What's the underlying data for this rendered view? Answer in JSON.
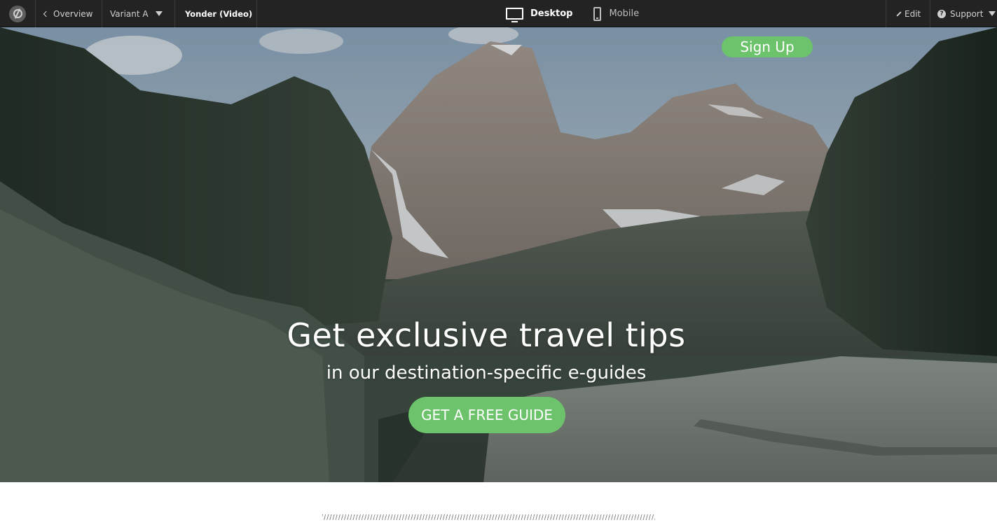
{
  "toolbar": {
    "overview_label": "Overview",
    "variant_label": "Variant A",
    "page_name": "Yonder (Video)",
    "devices": [
      {
        "label": "Desktop",
        "icon": "desktop-icon",
        "active": true
      },
      {
        "label": "Mobile",
        "icon": "mobile-icon",
        "active": false
      }
    ],
    "edit_label": "Edit",
    "support_label": "Support"
  },
  "hero": {
    "signup_label": "Sign Up",
    "title": "Get exclusive travel tips",
    "subtitle": "in our destination-specific e-guides",
    "cta_label": "GET A FREE GUIDE",
    "background": "mountain-landscape-video"
  },
  "colors": {
    "toolbar_bg": "#232323",
    "accent_green": "#6cc36b",
    "page_bg": "#ffffff"
  }
}
